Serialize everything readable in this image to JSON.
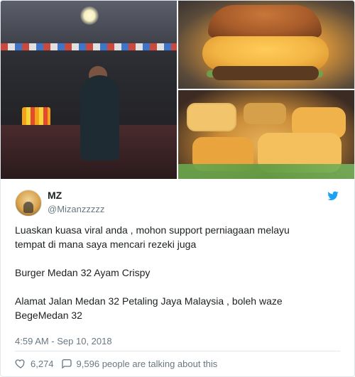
{
  "tweet": {
    "user": {
      "name": "MZ",
      "handle": "@Mizanzzzzz"
    },
    "text": "Luaskan kuasa viral anda , mohon support perniagaan melayu\ntempat di mana saya mencari rezeki juga\n\nBurger Medan 32 Ayam Crispy\n\nAlamat Jalan Medan 32 Petaling Jaya Malaysia , boleh waze\nBegeMedan 32",
    "timestamp": "4:59 AM - Sep 10, 2018",
    "actions": {
      "likes": "6,274",
      "talking": "9,596 people are talking about this"
    }
  },
  "icons": {
    "brand": "twitter-bird-icon",
    "like": "heart-icon",
    "reply": "comment-bubble-icon"
  },
  "colors": {
    "twitter_blue": "#1da1f2",
    "text": "#1c2022",
    "muted": "#697882",
    "border": "#e1e8ed"
  }
}
